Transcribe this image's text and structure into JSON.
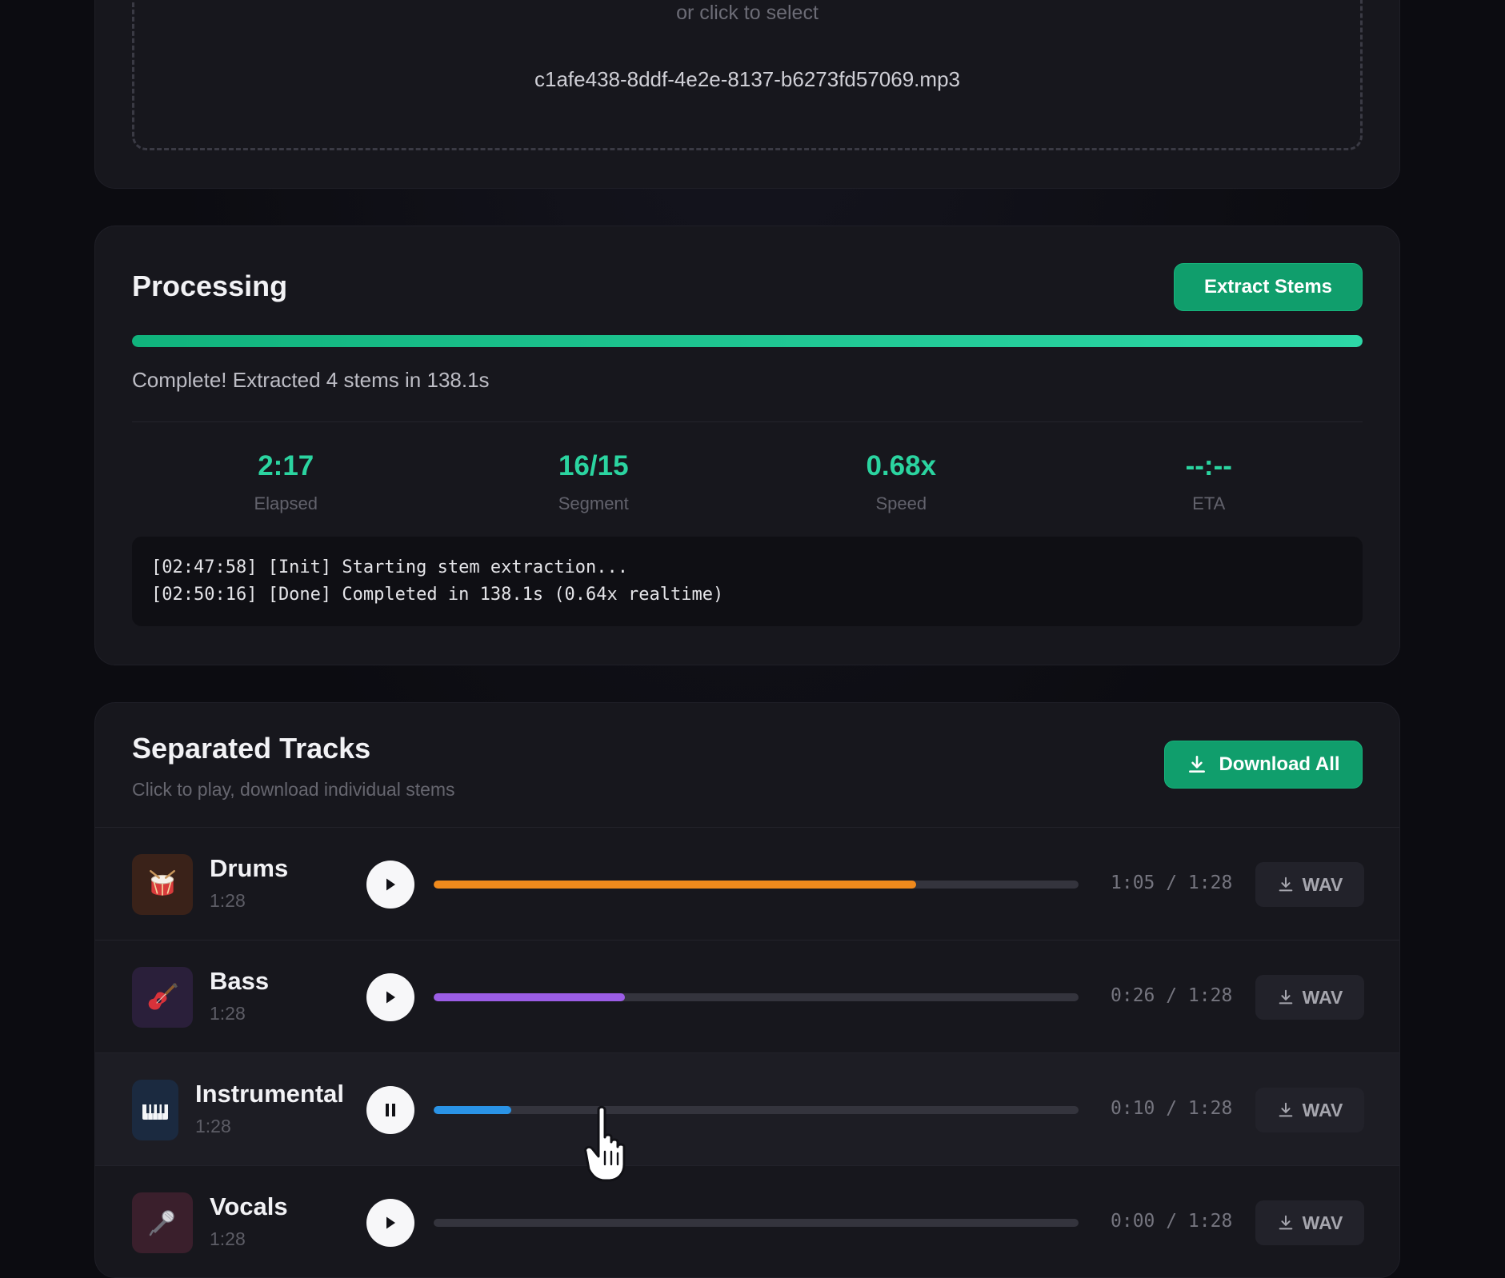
{
  "upload": {
    "hint": "or click to select",
    "filename": "c1afe438-8ddf-4e2e-8137-b6273fd57069.mp3"
  },
  "processing": {
    "title": "Processing",
    "extract_button": "Extract Stems",
    "progress_percent": 100,
    "status": "Complete! Extracted 4 stems in 138.1s",
    "stats": [
      {
        "value": "2:17",
        "label": "Elapsed"
      },
      {
        "value": "16/15",
        "label": "Segment"
      },
      {
        "value": "0.68x",
        "label": "Speed"
      },
      {
        "value": "--:--",
        "label": "ETA"
      }
    ],
    "log": [
      "[02:47:58] [Init] Starting stem extraction...",
      "[02:50:16] [Done] Completed in 138.1s (0.64x realtime)"
    ]
  },
  "tracks": {
    "title": "Separated Tracks",
    "subtitle": "Click to play, download individual stems",
    "download_all": "Download All",
    "items": [
      {
        "name": "Drums",
        "duration": "1:28",
        "time": "1:05 / 1:28",
        "progress": 0.748,
        "color": "#f08a1c",
        "icon": "drum-icon",
        "state": "paused",
        "download": "WAV"
      },
      {
        "name": "Bass",
        "duration": "1:28",
        "time": "0:26 / 1:28",
        "progress": 0.296,
        "color": "#9b5de5",
        "icon": "guitar-icon",
        "state": "paused",
        "download": "WAV"
      },
      {
        "name": "Instrumental",
        "duration": "1:28",
        "time": "0:10 / 1:28",
        "progress": 0.12,
        "color": "#2a93e6",
        "icon": "piano-icon",
        "state": "playing",
        "download": "WAV"
      },
      {
        "name": "Vocals",
        "duration": "1:28",
        "time": "0:00 / 1:28",
        "progress": 0,
        "color": "#d04a82",
        "icon": "microphone-icon",
        "state": "paused",
        "download": "WAV"
      }
    ]
  }
}
